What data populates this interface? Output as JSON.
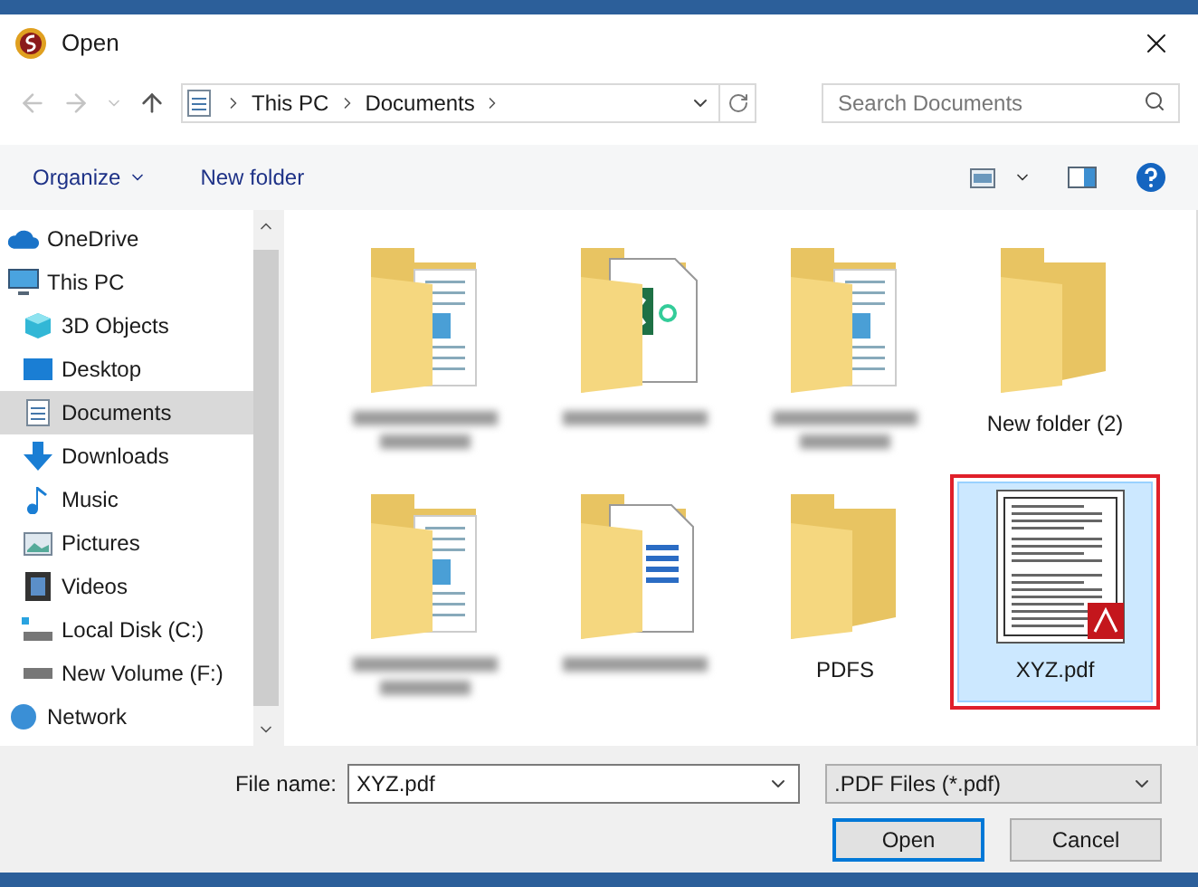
{
  "window": {
    "title": "Open"
  },
  "address": {
    "crumbs": [
      "This PC",
      "Documents"
    ]
  },
  "search": {
    "placeholder": "Search Documents"
  },
  "toolbar": {
    "organize": "Organize",
    "new_folder": "New folder"
  },
  "sidebar": {
    "items": [
      {
        "label": "OneDrive",
        "kind": "cloud",
        "selected": false
      },
      {
        "label": "This PC",
        "kind": "pc",
        "selected": false,
        "children": [
          {
            "label": "3D Objects",
            "kind": "objects",
            "selected": false
          },
          {
            "label": "Desktop",
            "kind": "desktop",
            "selected": false
          },
          {
            "label": "Documents",
            "kind": "documents",
            "selected": true
          },
          {
            "label": "Downloads",
            "kind": "downloads",
            "selected": false
          },
          {
            "label": "Music",
            "kind": "music",
            "selected": false
          },
          {
            "label": "Pictures",
            "kind": "pictures",
            "selected": false
          },
          {
            "label": "Videos",
            "kind": "videos",
            "selected": false
          },
          {
            "label": "Local Disk (C:)",
            "kind": "system_drive",
            "selected": false
          },
          {
            "label": "New Volume (F:)",
            "kind": "drive",
            "selected": false
          }
        ]
      },
      {
        "label": "Network",
        "kind": "network",
        "selected": false
      }
    ]
  },
  "files": [
    {
      "kind": "docs_folder",
      "selected": false,
      "highlighted": false
    },
    {
      "kind": "excel_folder",
      "selected": false,
      "highlighted": false
    },
    {
      "kind": "docs_folder",
      "selected": false,
      "highlighted": false
    },
    {
      "kind": "folder",
      "label": "New folder (2)",
      "selected": false,
      "highlighted": false
    },
    {
      "kind": "docs_folder",
      "selected": false,
      "highlighted": false
    },
    {
      "kind": "word_folder",
      "selected": false,
      "highlighted": false
    },
    {
      "kind": "folder",
      "label": "PDFS",
      "selected": false,
      "highlighted": false
    },
    {
      "kind": "pdf",
      "label": "XYZ.pdf",
      "selected": true,
      "highlighted": true
    }
  ],
  "footer": {
    "file_name_label": "File name:",
    "file_name": "XYZ.pdf",
    "file_type": ".PDF Files (*.pdf)",
    "buttons": [
      {
        "label": "Open",
        "default": true
      },
      {
        "label": "Cancel",
        "default": false
      }
    ]
  }
}
